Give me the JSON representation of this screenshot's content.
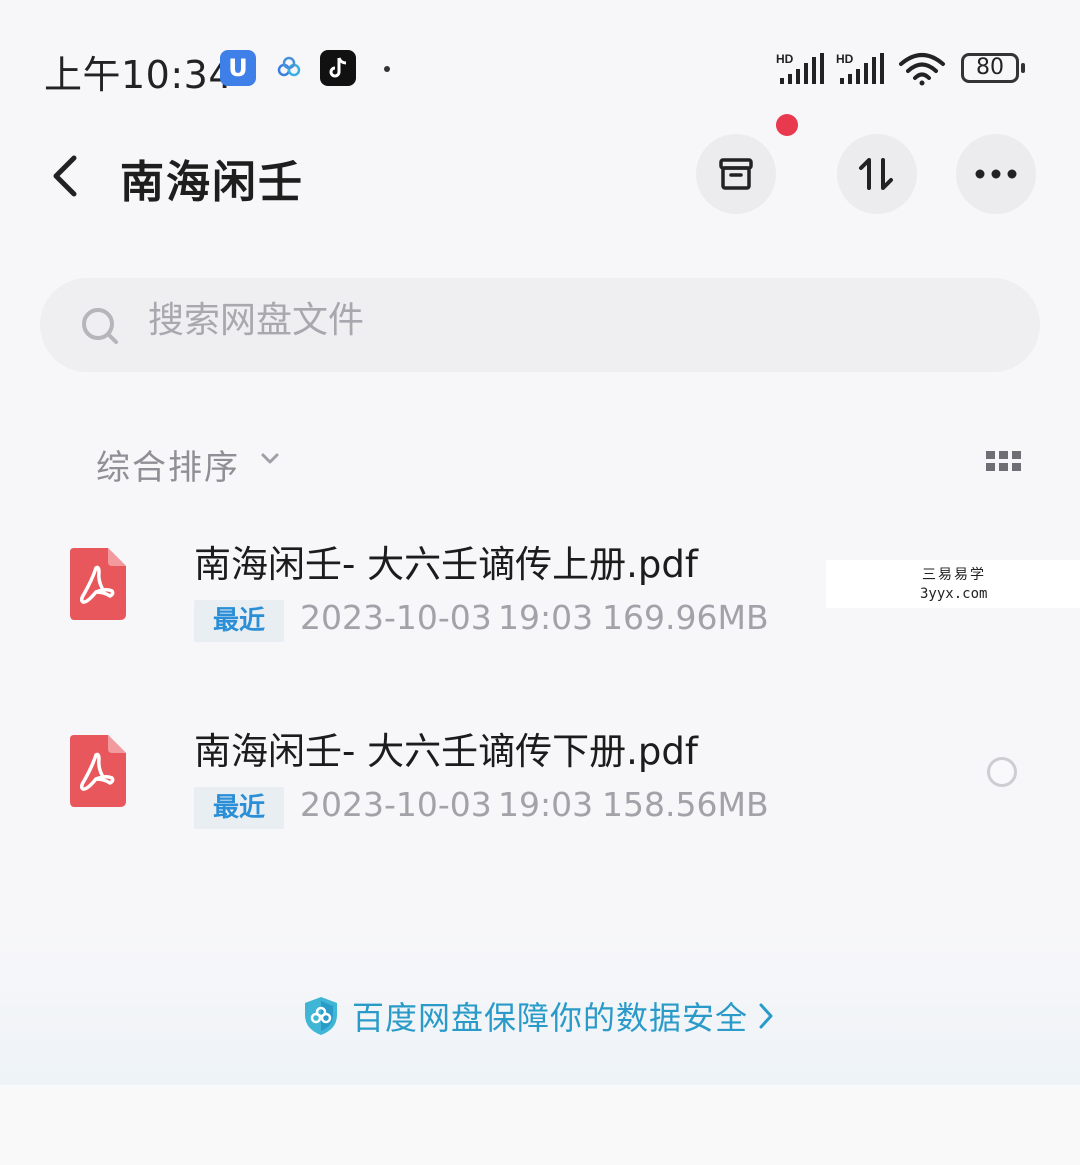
{
  "status_bar": {
    "time": "上午10:34",
    "app_badge": "U",
    "signal_label": "HD",
    "battery": "80"
  },
  "header": {
    "title": "南海闲壬"
  },
  "search": {
    "placeholder": "搜索网盘文件"
  },
  "sort": {
    "label": "综合排序"
  },
  "files": [
    {
      "name": "南海闲壬- 大六壬谪传上册.pdf",
      "tag": "最近",
      "date": "2023-10-03",
      "time": "19:03",
      "size": "169.96MB"
    },
    {
      "name": "南海闲壬- 大六壬谪传下册.pdf",
      "tag": "最近",
      "date": "2023-10-03",
      "time": "19:03",
      "size": "158.56MB"
    }
  ],
  "watermark": {
    "line1": "三易易学",
    "line2": "3yyx.com"
  },
  "footer": {
    "text": "百度网盘保障你的数据安全"
  },
  "colors": {
    "accent": "#2a9bc8",
    "notification": "#e8394f",
    "pdf": "#e8575c",
    "tag_text": "#2a8fd6"
  }
}
